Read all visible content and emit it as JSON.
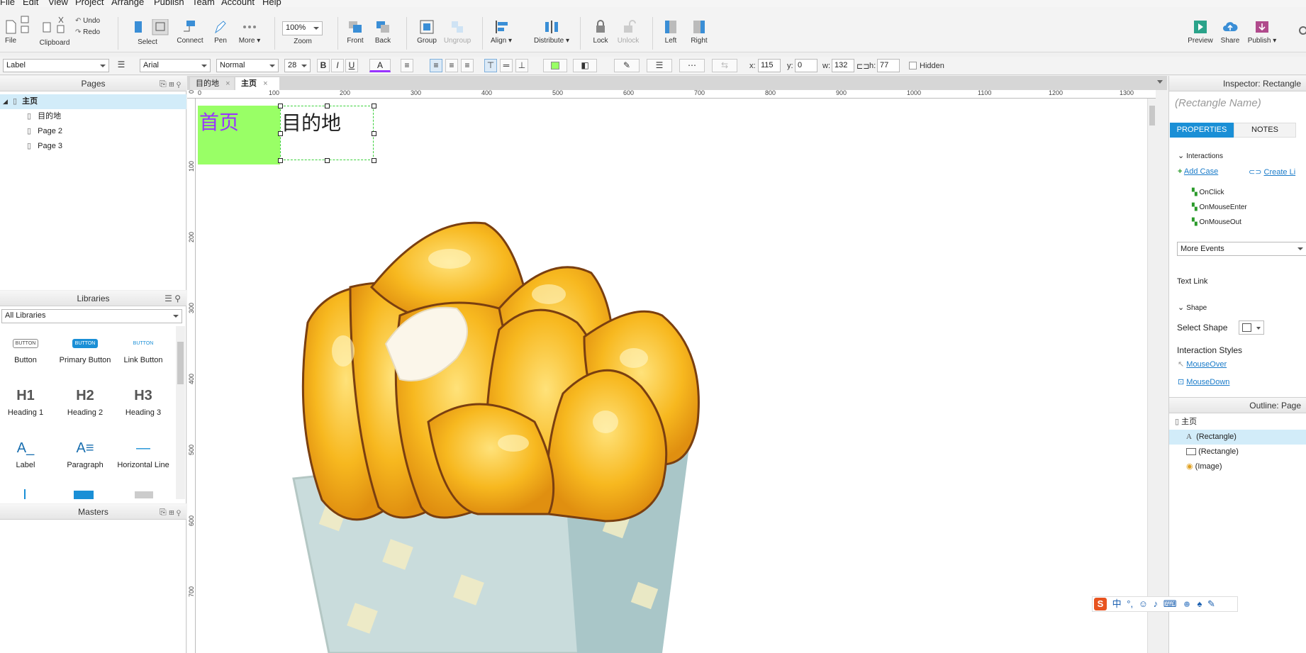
{
  "menu": [
    "File",
    "Edit",
    "View",
    "Project",
    "Arrange",
    "Publish",
    "Team",
    "Account",
    "Help"
  ],
  "toolbar": {
    "file": "File",
    "clipboard": "Clipboard",
    "undo": "Undo",
    "redo": "Redo",
    "select": "Select",
    "connect": "Connect",
    "pen": "Pen",
    "more": "More ▾",
    "zoom_value": "100%",
    "zoom": "Zoom",
    "front": "Front",
    "back": "Back",
    "group": "Group",
    "ungroup": "Ungroup",
    "align": "Align ▾",
    "distribute": "Distribute ▾",
    "lock": "Lock",
    "unlock": "Unlock",
    "left": "Left",
    "right": "Right",
    "preview": "Preview",
    "share": "Share",
    "publish": "Publish ▾"
  },
  "format": {
    "widget_type": "Label",
    "font": "Arial",
    "weight": "Normal",
    "size": "28",
    "bold": "B",
    "italic": "I",
    "underline": "U",
    "font_color_glyph": "A",
    "x_label": "x:",
    "x": "115",
    "y_label": "y:",
    "y": "0",
    "w_label": "w:",
    "w": "132",
    "h_label": "h:",
    "h": "77",
    "hidden": "Hidden"
  },
  "pages": {
    "title": "Pages",
    "items": [
      {
        "label": "主页",
        "level": 0
      },
      {
        "label": "目的地",
        "level": 1
      },
      {
        "label": "Page 2",
        "level": 1
      },
      {
        "label": "Page 3",
        "level": 1
      }
    ]
  },
  "libraries": {
    "title": "Libraries",
    "selected": "All Libraries",
    "items": [
      {
        "label": "Button",
        "glyph": "BUTTON"
      },
      {
        "label": "Primary Button",
        "glyph": "BUTTON"
      },
      {
        "label": "Link Button",
        "glyph": "BUTTON"
      },
      {
        "label": "Heading 1",
        "glyph": "H1"
      },
      {
        "label": "Heading 2",
        "glyph": "H2"
      },
      {
        "label": "Heading 3",
        "glyph": "H3"
      },
      {
        "label": "Label",
        "glyph": "A_"
      },
      {
        "label": "Paragraph",
        "glyph": "A≡"
      },
      {
        "label": "Horizontal Line",
        "glyph": "—"
      }
    ]
  },
  "masters": {
    "title": "Masters"
  },
  "tabs": [
    {
      "label": "目的地",
      "active": false
    },
    {
      "label": "主页",
      "active": true
    }
  ],
  "ruler": {
    "h": [
      "0",
      "100",
      "200",
      "300",
      "400",
      "500",
      "600",
      "700",
      "800",
      "900",
      "1000",
      "1100",
      "1200",
      "1300"
    ],
    "v": [
      "0",
      "100",
      "200",
      "300",
      "400",
      "500",
      "600",
      "700"
    ]
  },
  "canvas": {
    "home_text": "首页",
    "dest_text": "目的地",
    "home_color": "#99ff66",
    "home_text_color": "#9933ff"
  },
  "inspector": {
    "title": "Inspector: Rectangle",
    "name_placeholder": "(Rectangle Name)",
    "tab_properties": "PROPERTIES",
    "tab_notes": "NOTES",
    "interactions": "Interactions",
    "add_case": "Add Case",
    "create_link": "Create Li",
    "events": [
      "OnClick",
      "OnMouseEnter",
      "OnMouseOut"
    ],
    "more_events": "More Events",
    "text_link": "Text Link",
    "shape": "Shape",
    "select_shape": "Select Shape",
    "interaction_styles": "Interaction Styles",
    "mouse_over": "MouseOver",
    "mouse_down": "MouseDown"
  },
  "outline": {
    "title": "Outline: Page",
    "items": [
      {
        "label": "主页",
        "kind": "page"
      },
      {
        "label": "(Rectangle)",
        "kind": "text",
        "selected": true
      },
      {
        "label": "(Rectangle)",
        "kind": "rect",
        "selected": false
      },
      {
        "label": "(Image)",
        "kind": "image",
        "selected": false
      }
    ]
  },
  "ime": {
    "lang": "中",
    "punct": "°,"
  }
}
